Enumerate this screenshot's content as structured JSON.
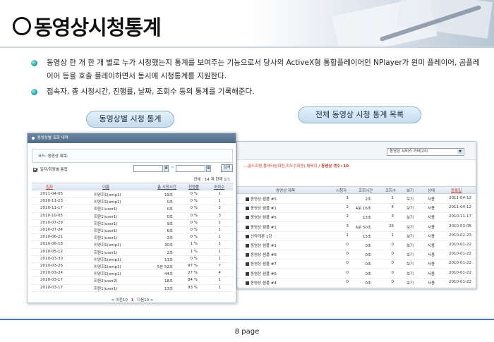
{
  "header": {
    "title": "동영상시청통계"
  },
  "bullets": [
    "동영상 한 개 한 개 별로 누가 시청했는지 통계를 보여주는 기능으로서 당사의 ActiveX형 통합플레이어인 NPlayer가 윈미 플레이어, 곰플레이어 등을 호출 플레이하면서 동시에 시청통계를 지원한다.",
    "접속자, 총 시청시간, 진행률, 날짜, 조회수 등의 통계를 기록해준다."
  ],
  "labels": {
    "left": "동영상별 시청 통계",
    "right": "전체 동영상 시청 통계 목록"
  },
  "left_panel": {
    "title": "동영상별 조회 내역",
    "filter_label": "코드: 동영상 제목:",
    "checkbox_label": "일자/회원별 통합",
    "date_sep": "~",
    "search_label": "검색",
    "total": "전체 : 14 개  현재 1/1",
    "columns": [
      "일자",
      "이름",
      "총 시청시간",
      "진행률",
      "조회수"
    ],
    "rows": [
      [
        "2011-04-06",
        "이영희1(emp1)",
        "19초",
        "0 %",
        "1"
      ],
      [
        "2010-11-23",
        "이영희1(emp1)",
        "0초",
        "0 %",
        "1"
      ],
      [
        "2010-11-17",
        "회원1(user1)",
        "0초",
        "0 %",
        "2"
      ],
      [
        "2010-10-05",
        "회원1(user1)",
        "0초",
        "0 %",
        "3"
      ],
      [
        "2010-07-29",
        "회원1(user1)",
        "9초",
        "0 %",
        "1"
      ],
      [
        "2010-07-24",
        "회원1(user1)",
        "6초",
        "0 %",
        "1"
      ],
      [
        "2010-06-21",
        "회원1(user1)",
        "2초",
        "0 %",
        "1"
      ],
      [
        "2010-06-18",
        "이영희1(emp1)",
        "30초",
        "1 %",
        "1"
      ],
      [
        "2010-05-12",
        "회원1(user1)",
        "2초",
        "1 %",
        "1"
      ],
      [
        "2010-03-30",
        "이영희1(emp1)",
        "11초",
        "0 %",
        "1"
      ],
      [
        "2010-03-26",
        "이영희1(emp1)",
        "5분 52초",
        "97 %",
        "7"
      ],
      [
        "2010-03-24",
        "이영희1(emp1)",
        "44초",
        "27 %",
        "4"
      ],
      [
        "2010-03-17",
        "회원2(user2)",
        "18초",
        "84 %",
        "1"
      ],
      [
        "2010-03-17",
        "회원1(user1)",
        "13초",
        "93 %",
        "1"
      ]
    ],
    "pager": {
      "prev": "< 이전10",
      "current": "1",
      "next": "다음10 >"
    }
  },
  "right_panel": {
    "select_value": "동영상 서비스 카테고리",
    "filter_prefix": "...,골드회원,플래티넘회원,최우수회원),체육회",
    "filter_suffix": "/ 동영상 갯수: 10",
    "columns": [
      "동영상 제목",
      "시청자",
      "조회시간",
      "조회수",
      "보기",
      "상태",
      "등록일"
    ],
    "rows": [
      [
        "동영상 샘플 #5",
        "1",
        "2초",
        "1",
        "보기",
        "사용",
        "2011-04-12"
      ],
      [
        "동영상 샘플 #1",
        "2",
        "4분 16초",
        "4",
        "보기",
        "사용",
        "2011-04-12"
      ],
      [
        "동영상 샘플 #5",
        "2",
        "13초",
        "3",
        "보기",
        "사용",
        "2010-11-17"
      ],
      [
        "동영상 샘플 #1",
        "3",
        "6분 50초",
        "26",
        "보기",
        "사용",
        "2010-03-05"
      ],
      [
        "신약개론 1강",
        "1",
        "13초",
        "1",
        "보기",
        "사용",
        "2010-02-23"
      ],
      [
        "동영상 샘플 #1",
        "0",
        "0초",
        "0",
        "보기",
        "사용",
        "2010-01-22"
      ],
      [
        "동영상 샘플 #8",
        "0",
        "0초",
        "0",
        "보기",
        "사용",
        "2010-01-22"
      ],
      [
        "동영상 샘플 #7",
        "0",
        "0초",
        "0",
        "보기",
        "사용",
        "2010-01-22"
      ],
      [
        "동영상 샘플 #6",
        "0",
        "0초",
        "0",
        "보기",
        "사용",
        "2010-01-22"
      ],
      [
        "동영상 샘플 #4",
        "0",
        "0초",
        "0",
        "보기",
        "사용",
        "2010-01-22"
      ]
    ]
  },
  "footer": {
    "page": "8 page"
  },
  "colors": {
    "accent": "#4a79a9",
    "bullet": "#2aa7b0",
    "highlight": "#c0392b"
  }
}
